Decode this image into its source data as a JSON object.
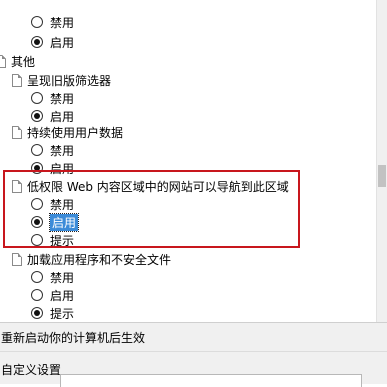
{
  "settings": {
    "opt_disable": "禁用",
    "opt_enable": "启用",
    "opt_prompt": "提示",
    "group_misc": "其他",
    "item_legacy_filters": "呈现旧版筛选器",
    "item_persist_user_data": "持续使用用户数据",
    "item_low_priv_web_nav": "低权限 Web 内容区域中的网站可以导航到此区域",
    "item_load_apps_unsafe": "加载应用程序和不安全文件"
  },
  "status": {
    "restart_note": "重新启动你的计算机后生效"
  },
  "bottom": {
    "custom_settings": "自定义设置"
  },
  "colors": {
    "highlight_box": "#c8161d",
    "selection": "#3c8bd8"
  }
}
